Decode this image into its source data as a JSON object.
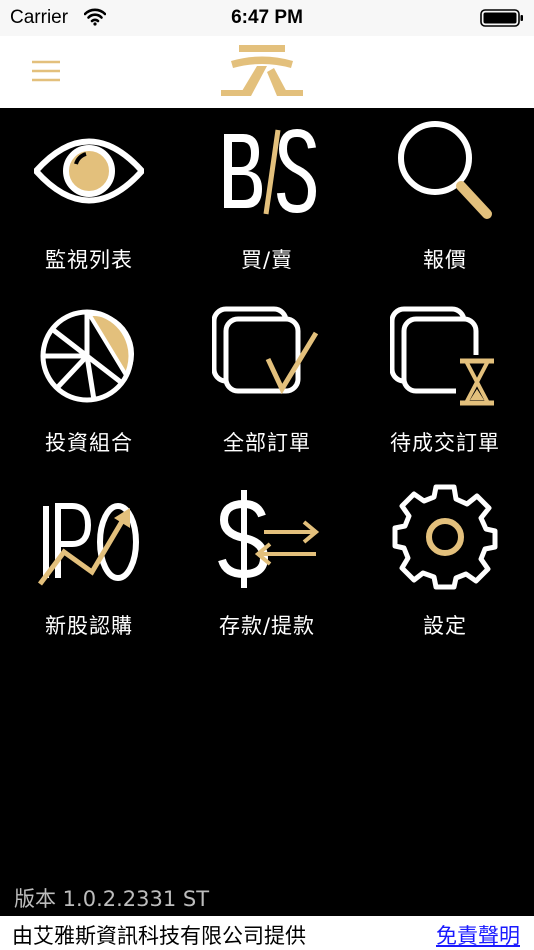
{
  "status_bar": {
    "carrier": "Carrier",
    "time": "6:47 PM",
    "icons": [
      "wifi-icon",
      "battery-icon"
    ]
  },
  "nav_bar": {
    "menu_icon": "hamburger-menu-icon",
    "logo_icon": "brand-logo-icon"
  },
  "menu": {
    "items": [
      {
        "label": "監視列表",
        "icon": "eye-icon"
      },
      {
        "label": "買/賣",
        "icon": "buy-sell-icon"
      },
      {
        "label": "報價",
        "icon": "magnifier-icon"
      },
      {
        "label": "投資組合",
        "icon": "pie-chart-icon"
      },
      {
        "label": "全部訂單",
        "icon": "orders-check-icon"
      },
      {
        "label": "待成交訂單",
        "icon": "pending-orders-icon"
      },
      {
        "label": "新股認購",
        "icon": "ipo-icon"
      },
      {
        "label": "存款/提款",
        "icon": "dollar-transfer-icon"
      },
      {
        "label": "設定",
        "icon": "gear-icon"
      }
    ]
  },
  "version": "版本 1.0.2.2331 ST",
  "footer": {
    "provider": "由艾雅斯資訊科技有限公司提供",
    "disclaimer": "免責聲明"
  },
  "colors": {
    "gold": "#e3c07c",
    "background": "#000000",
    "text": "#ffffff"
  }
}
